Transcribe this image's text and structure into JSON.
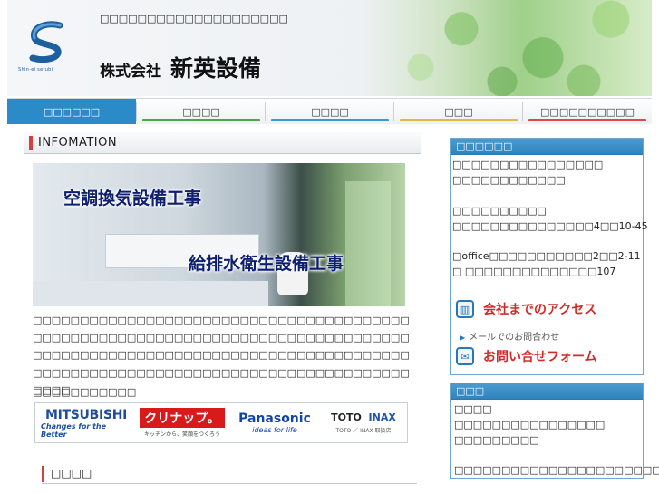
{
  "header": {
    "tagline": "□□□□□□□□□□□□□□□□□□□□",
    "logo_caption": "Shin-ei setubi",
    "company_kind": "株式会社",
    "company_name": "新英設備"
  },
  "nav": {
    "items": [
      {
        "label": "□□□□□□",
        "accent": "#2a8bc8"
      },
      {
        "label": "□□□□",
        "accent": "#4aa84a"
      },
      {
        "label": "□□□□",
        "accent": "#3a9ad0"
      },
      {
        "label": "□□□",
        "accent": "#e0b84a"
      },
      {
        "label": "□□□□□□□□□□",
        "accent": "#d94a4a"
      }
    ]
  },
  "main": {
    "section_title": "INFOMATION",
    "hero_text_1": "空調換気設備工事",
    "hero_text_2": "給排水衛生設備工事",
    "intro": "□□□□□□□□□□□□□□□□□□□□□□□□□□□□□□□□□□□□□□□□□□□□□□□□□□□□□□□□□□□□□□□□□□□□□□□□□□□□□□□□□□□□□□□□□□□□□□□□□□□□□□□□□□□□□□□□□□□□□□□□□□□□□□□□□□□□□□□□□□□□□□□□□□□□□□□□□□□□□□□□□□□□",
    "brands_label": "□□□□□□□□□□□",
    "brands": {
      "mitsubishi": "MITSUBISHI",
      "mitsubishi_tag": "Changes for the Better",
      "cleanup": "クリナップ。",
      "cleanup_tag": "キッチンから、笑顔をつくろう",
      "panasonic": "Panasonic",
      "panasonic_tag": "ideas for life",
      "toto": "TOTO",
      "inax": "INAX",
      "toto_tag": "TOTO ／ INAX 取扱店"
    },
    "section2_title": "□□□□"
  },
  "sidebar": {
    "company_head": "□□□□□□",
    "lines": [
      "□□□□□□□□□□□□□□□□",
      "□□□□□□□□□□□□",
      "",
      "□□□□□□□□□□",
      "□□□□□□□□□□□□□□□4□□10-45",
      "",
      "□office□□□□□□□□□□□2□□2-11",
      "□ □□□□□□□□□□□□□□107"
    ],
    "access_label": "会社までのアクセス",
    "mail_note": "メールでのお問合わせ",
    "contact_label": "お問い合せフォーム",
    "eigyo_head": "□□□",
    "eigyo_lines": [
      "□□□□",
      "□□□□□□□□□□□□□□□□",
      "□□□□□□□□□",
      "",
      "□□□□□□□□□□□□□□□□□□□□□□□□□□□"
    ]
  },
  "icons": [
    "shin-ei-logo-icon",
    "building-icon",
    "mail-icon",
    "triangle-right-icon"
  ]
}
